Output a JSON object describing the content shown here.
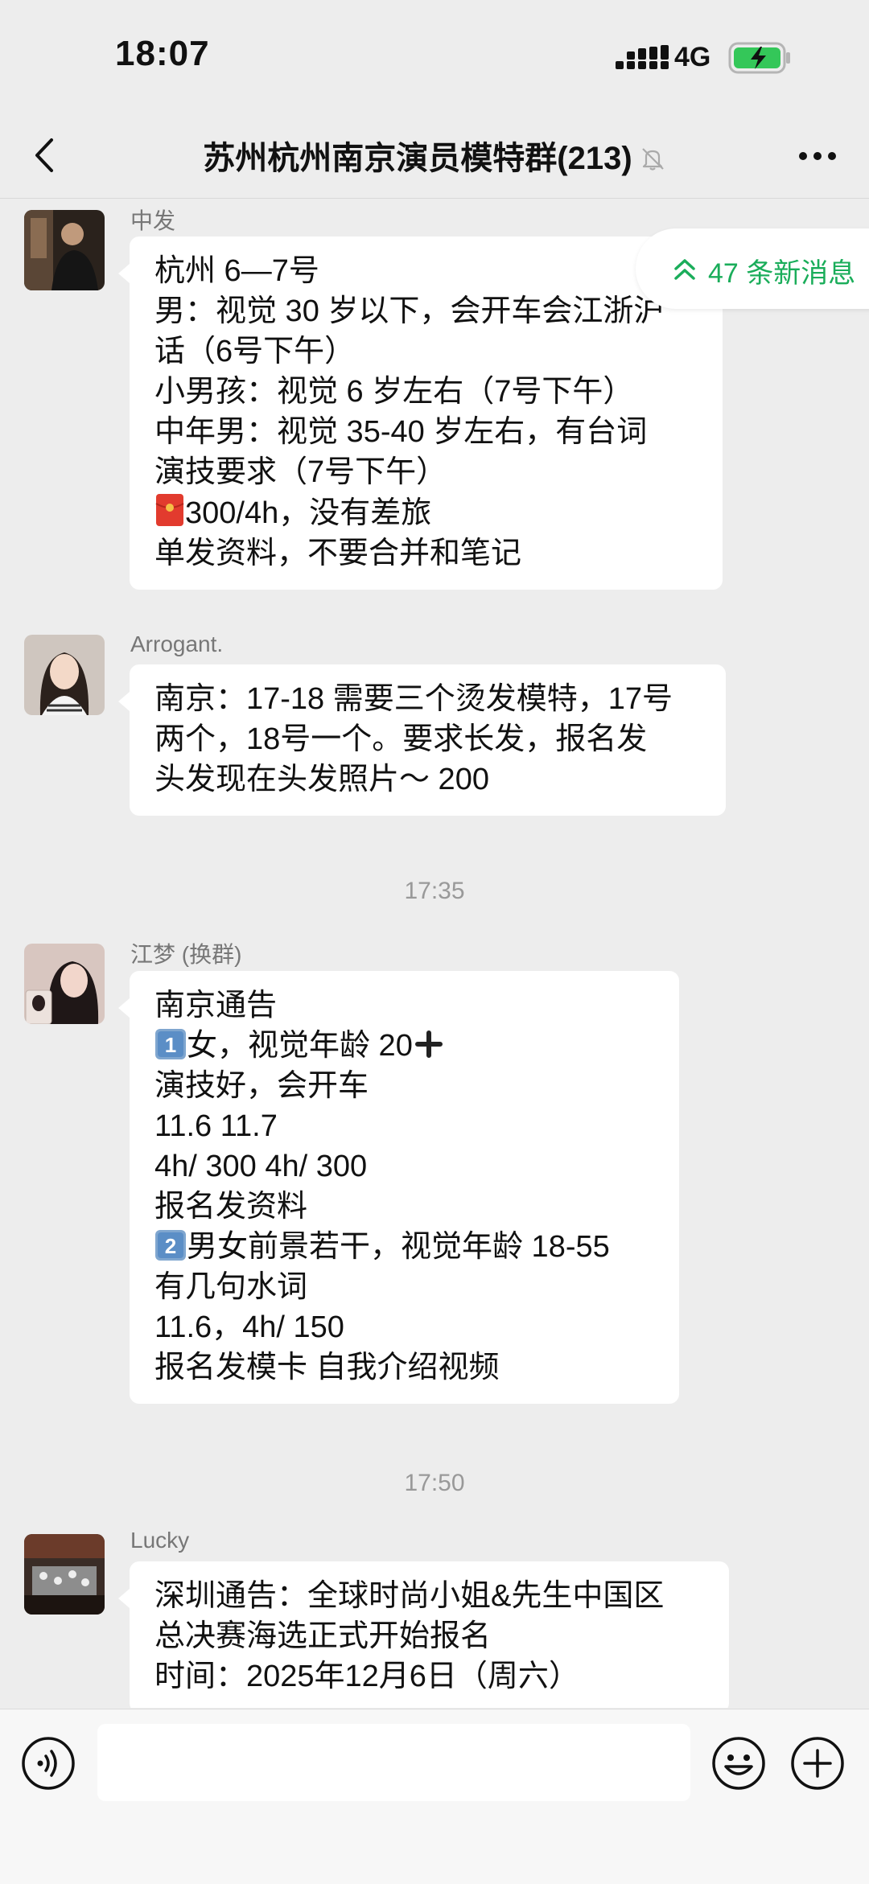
{
  "status": {
    "time": "18:07",
    "network": "4G"
  },
  "nav": {
    "title": "苏州杭州南京演员模特群(213)"
  },
  "new_messages": "47 条新消息",
  "messages": [
    {
      "sender": "中发",
      "lines": [
        "杭州 6—7号",
        "男：视觉 30 岁以下，会开车会江浙沪",
        "话（6号下午）",
        "小男孩：视觉 6 岁左右（7号下午）",
        "中年男：视觉 35-40 岁左右，有台词",
        "演技要求（7号下午）",
        "300/4h，没有差旅",
        "单发资料，不要合并和笔记"
      ]
    },
    {
      "sender": "Arrogant.",
      "lines": [
        "南京：17-18 需要三个烫发模特，17号",
        "两个，18号一个。要求长发，报名发",
        "头发现在头发照片～ 200"
      ]
    },
    {
      "sender": "江梦 (换群)",
      "lines": [
        "南京通告",
        "女，视觉年龄 20",
        "演技好，会开车",
        "11.6 11.7",
        "4h/ 300 4h/ 300",
        "报名发资料",
        "男女前景若干，视觉年龄 18-55",
        "有几句水词",
        "11.6，4h/ 150",
        "报名发模卡 自我介绍视频"
      ]
    },
    {
      "sender": "Lucky",
      "lines": [
        "深圳通告：全球时尚小姐&先生中国区",
        "总决赛海选正式开始报名",
        "时间：2025年12月6日（周六）"
      ]
    }
  ],
  "timestamps": [
    "17:35",
    "17:50"
  ],
  "colors": {
    "background": "#EDEDED",
    "bubble": "#FFFFFF",
    "accent": "#1AAD5A"
  },
  "icons": [
    "back-icon",
    "mute-icon",
    "more-icon",
    "red-envelope-icon",
    "money-bag-icon",
    "plus-icon",
    "keycap-1-icon",
    "keycap-2-icon",
    "voice-icon",
    "emoji-icon",
    "add-icon"
  ]
}
